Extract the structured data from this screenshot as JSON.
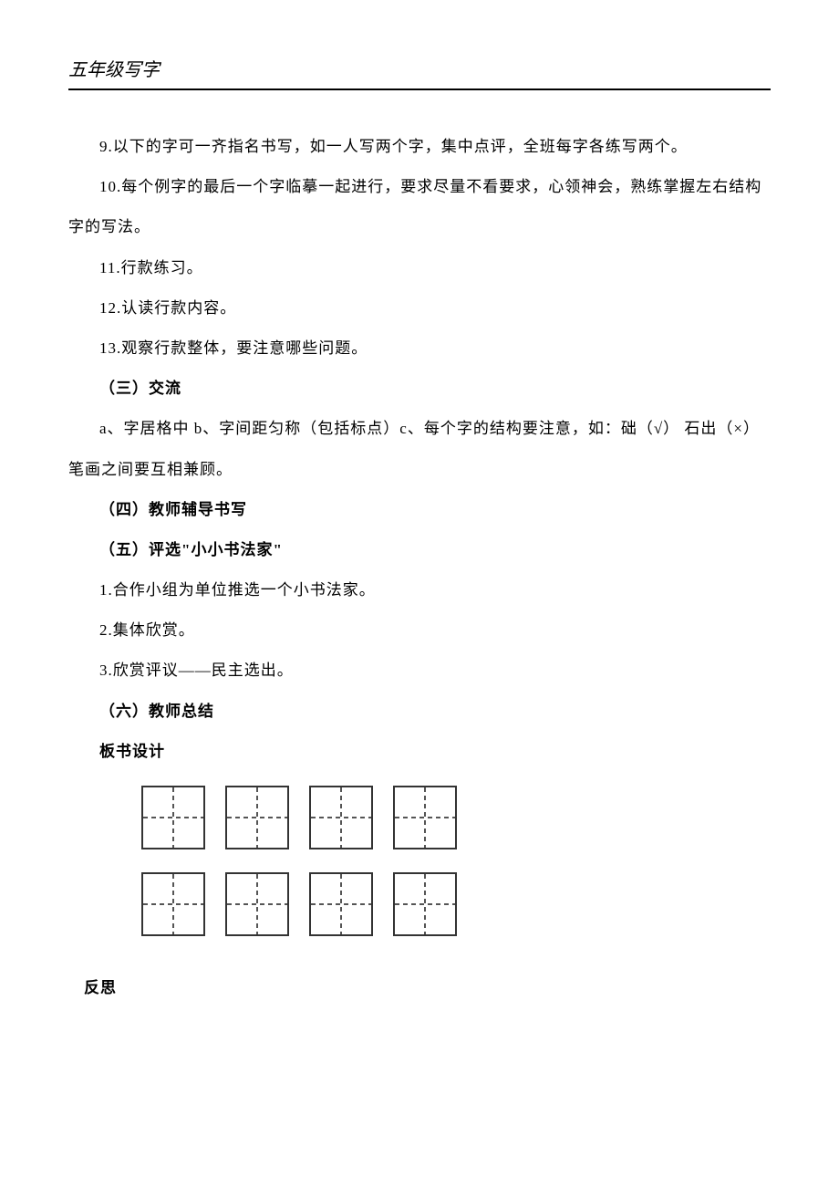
{
  "header": {
    "title": "五年级写字"
  },
  "body": {
    "p1": "9.以下的字可一齐指名书写，如一人写两个字，集中点评，全班每字各练写两个。",
    "p2": "10.每个例字的最后一个字临摹一起进行，要求尽量不看要求，心领神会，熟练掌握左右结构字的写法。",
    "p3": "11.行款练习。",
    "p4": "12.认读行款内容。",
    "p5": "13.观察行款整体，要注意哪些问题。",
    "h3": "（三）交流",
    "p6": "a、字居格中 b、字间距匀称（包括标点）c、每个字的结构要注意，如：础（√）  石出（×）  笔画之间要互相兼顾。",
    "h4": "（四）教师辅导书写",
    "h5": "（五）评选\"小小书法家\"",
    "p7": "1.合作小组为单位推选一个小书法家。",
    "p8": "2.集体欣赏。",
    "p9": "3.欣赏评议——民主选出。",
    "h6": "（六）教师总结",
    "board_design": "板书设计",
    "reflect": "反思"
  }
}
